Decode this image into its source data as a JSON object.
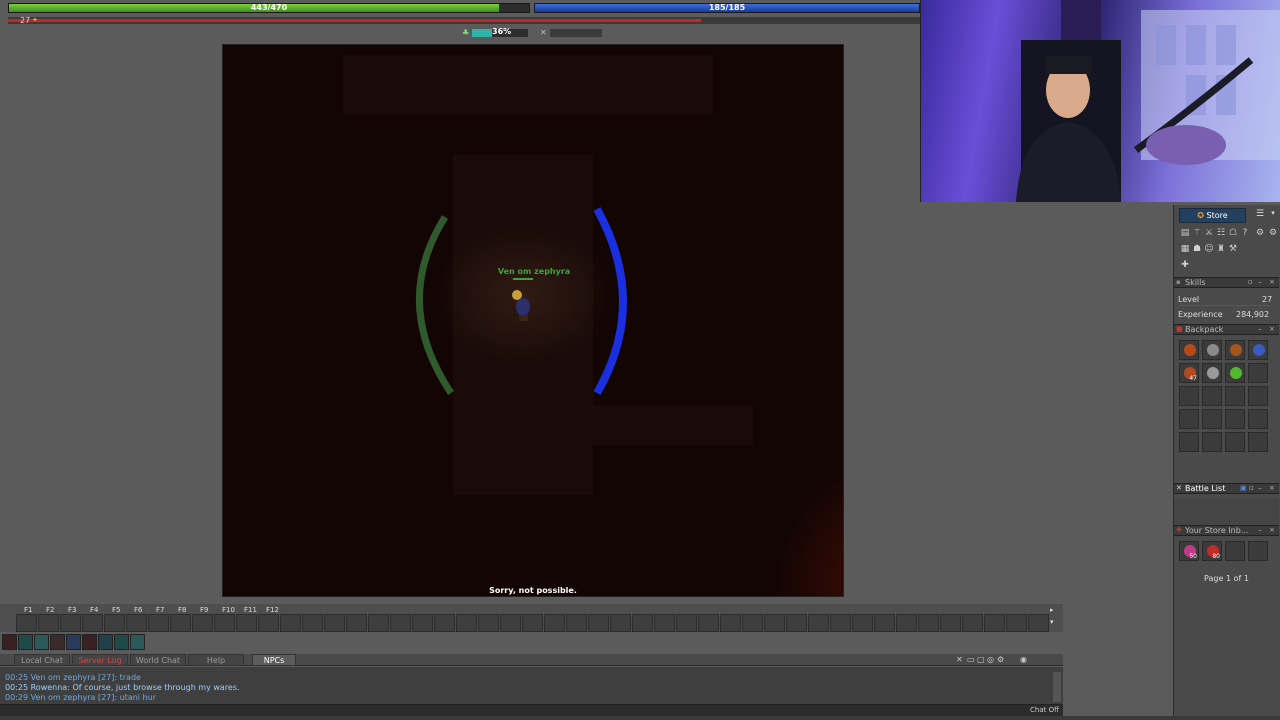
{
  "colors": {
    "hp": "#4fae2c",
    "mana": "#2a52c4",
    "experience": "#c62727",
    "stamina": "#2fb5a6",
    "store_button": "#23405e",
    "server_log_tab": "#d84444"
  },
  "stats": {
    "hp_text": "443/470",
    "hp_fraction": 0.9426,
    "mana_text": "185/185",
    "mana_fraction": 1.0,
    "level": "27",
    "xp_fraction": 0.76,
    "xp_icon": "xp-icon",
    "stamina_icon": "stamina-icon",
    "stamina_percent": "36%",
    "stamina_fraction": 0.36
  },
  "game": {
    "player_name": "Ven om zephyra",
    "status_message": "Sorry, not possible."
  },
  "right_panel": {
    "store_label": "Store",
    "skills": {
      "title": "Skills",
      "level_label": "Level",
      "level_value": "27",
      "experience_label": "Experience",
      "experience_value": "284,902"
    },
    "backpack": {
      "title": "Backpack",
      "items": [
        {
          "icon": "amulet-icon",
          "color": "#b84a1a",
          "count": ""
        },
        {
          "icon": "sword-icon",
          "color": "#8a8a8a",
          "count": ""
        },
        {
          "icon": "shield-icon",
          "color": "#a4551f",
          "count": ""
        },
        {
          "icon": "ring-icon",
          "color": "#3a5cbf",
          "count": ""
        },
        {
          "icon": "backpack-icon",
          "color": "#b04a22",
          "count": "47"
        },
        {
          "icon": "staff-icon",
          "color": "#9a9a9a",
          "count": ""
        },
        {
          "icon": "herb-icon",
          "color": "#53b82d",
          "count": ""
        }
      ]
    },
    "battle_list": {
      "title": "Battle List"
    },
    "store_inbox": {
      "title": "Your Store Inb...",
      "items": [
        {
          "icon": "potion-icon",
          "color": "#c23a8a",
          "count": "50"
        },
        {
          "icon": "health-potion-icon",
          "color": "#c22a2a",
          "count": "80"
        }
      ],
      "page_label": "Page 1 of 1"
    }
  },
  "hotkeys": [
    "F1",
    "F2",
    "F3",
    "F4",
    "F5",
    "F6",
    "F7",
    "F8",
    "F9",
    "F10",
    "F11",
    "F12"
  ],
  "chat": {
    "tabs": [
      {
        "label": "Local Chat",
        "state": "normal"
      },
      {
        "label": "Server Log",
        "state": "red"
      },
      {
        "label": "World Chat",
        "state": "normal"
      },
      {
        "label": "Help",
        "state": "normal"
      },
      {
        "label": "NPCs",
        "state": "active"
      }
    ],
    "lines": [
      "00:25 Ven om zephyra [27]: trade",
      "00:25 Rowenna: Of course, just browse through my wares.",
      "00:29 Ven om zephyra [27]: utani hur"
    ],
    "chat_off_label": "Chat Off"
  }
}
